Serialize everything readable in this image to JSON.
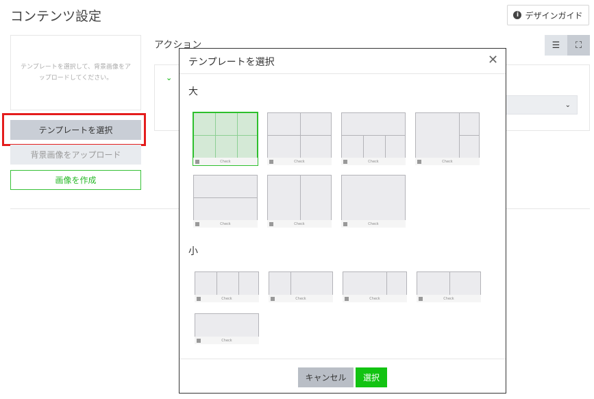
{
  "page": {
    "title": "コンテンツ設定",
    "guide_button": "デザインガイド",
    "info_icon": "i"
  },
  "left": {
    "upload_hint": "テンプレートを選択して、背景画像をアップロードしてください。",
    "select_template_button": "テンプレートを選択",
    "upload_background_button": "背景画像をアップロード",
    "create_image_button": "画像を作成"
  },
  "action": {
    "title": "アクション",
    "chevron": "⌄"
  },
  "view_toggle": {
    "list_icon": "☰",
    "expand_icon": "⛶"
  },
  "modal": {
    "title": "テンプレートを選択",
    "close": "✕",
    "large_label": "大",
    "small_label": "小",
    "template_footer_label": "Check",
    "cancel_button": "キャンセル",
    "select_button": "選択"
  },
  "colors": {
    "accent_green": "#12c312",
    "highlight_red": "#e41c1c"
  }
}
